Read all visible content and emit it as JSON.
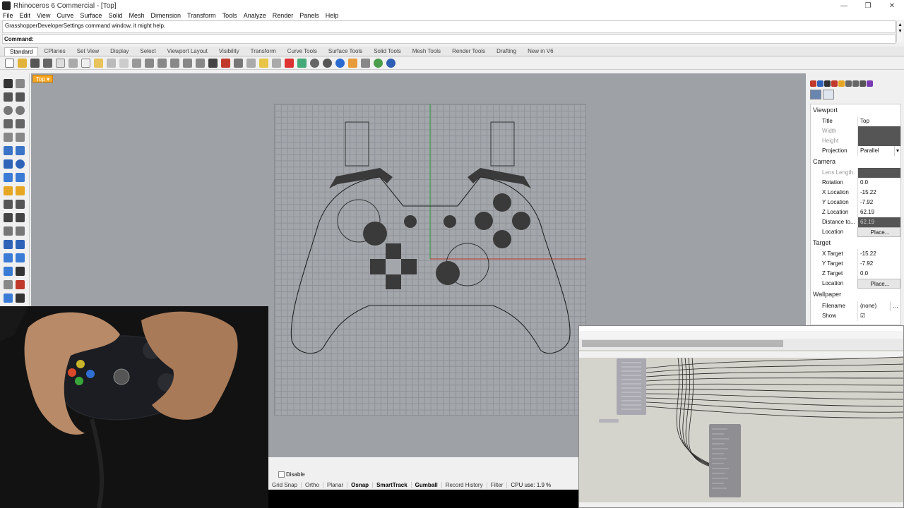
{
  "window": {
    "title": "Rhinoceros 6 Commercial - [Top]",
    "controls": [
      "—",
      "❐",
      "✕"
    ]
  },
  "menu": [
    "File",
    "Edit",
    "View",
    "Curve",
    "Surface",
    "Solid",
    "Mesh",
    "Dimension",
    "Transform",
    "Tools",
    "Analyze",
    "Render",
    "Panels",
    "Help"
  ],
  "command": {
    "history": "GrasshopperDeveloperSettings command window, it might help.",
    "prompt": "Command:"
  },
  "toolbar_tabs": [
    "Standard",
    "CPlanes",
    "Set View",
    "Display",
    "Select",
    "Viewport Layout",
    "Visibility",
    "Transform",
    "Curve Tools",
    "Surface Tools",
    "Solid Tools",
    "Mesh Tools",
    "Render Tools",
    "Drafting",
    "New in V6"
  ],
  "viewport": {
    "label": "Top",
    "dropdown": "▾"
  },
  "properties": {
    "viewport_header": "Viewport",
    "rows_viewport": [
      {
        "key": "Title",
        "value": "Top",
        "dim": false,
        "style": ""
      },
      {
        "key": "Width",
        "value": "",
        "dim": true,
        "style": "gray"
      },
      {
        "key": "Height",
        "value": "",
        "dim": true,
        "style": "gray"
      },
      {
        "key": "Projection",
        "value": "Parallel",
        "dim": false,
        "style": "select"
      }
    ],
    "camera_header": "Camera",
    "rows_camera": [
      {
        "key": "Lens Length",
        "value": "",
        "dim": true,
        "style": "gray"
      },
      {
        "key": "Rotation",
        "value": "0.0",
        "dim": false,
        "style": ""
      },
      {
        "key": "X Location",
        "value": "-15.22",
        "dim": false,
        "style": ""
      },
      {
        "key": "Y Location",
        "value": "-7.92",
        "dim": false,
        "style": ""
      },
      {
        "key": "Z Location",
        "value": "62.19",
        "dim": false,
        "style": ""
      },
      {
        "key": "Distance to...",
        "value": "62.19",
        "dim": false,
        "style": "gray"
      },
      {
        "key": "Location",
        "value": "Place...",
        "dim": false,
        "style": "btn"
      }
    ],
    "target_header": "Target",
    "rows_target": [
      {
        "key": "X Target",
        "value": "-15.22",
        "dim": false,
        "style": ""
      },
      {
        "key": "Y Target",
        "value": "-7.92",
        "dim": false,
        "style": ""
      },
      {
        "key": "Z Target",
        "value": "0.0",
        "dim": false,
        "style": ""
      },
      {
        "key": "Location",
        "value": "Place...",
        "dim": false,
        "style": "btn"
      }
    ],
    "wallpaper_header": "Wallpaper",
    "rows_wallpaper": [
      {
        "key": "Filename",
        "value": "(none)",
        "dim": false,
        "style": "browse"
      },
      {
        "key": "Show",
        "value": "☑",
        "dim": false,
        "style": ""
      }
    ]
  },
  "status": {
    "disable_label": "Disable",
    "items": [
      {
        "label": "Grid Snap",
        "on": false
      },
      {
        "label": "Ortho",
        "on": false
      },
      {
        "label": "Planar",
        "on": false
      },
      {
        "label": "Osnap",
        "on": true
      },
      {
        "label": "SmartTrack",
        "on": true
      },
      {
        "label": "Gumball",
        "on": true
      },
      {
        "label": "Record History",
        "on": false
      },
      {
        "label": "Filter",
        "on": false
      }
    ],
    "cpu": "CPU use: 1.9 %"
  },
  "colors": {
    "viewport_bg": "#9ea2a7",
    "x_axis": "#c0392b",
    "y_axis": "#2e9e3e",
    "shape_fill": "#3a3a3a",
    "viewport_tab": "#f5a623",
    "grasshopper_canvas": "#d4d3cc"
  }
}
